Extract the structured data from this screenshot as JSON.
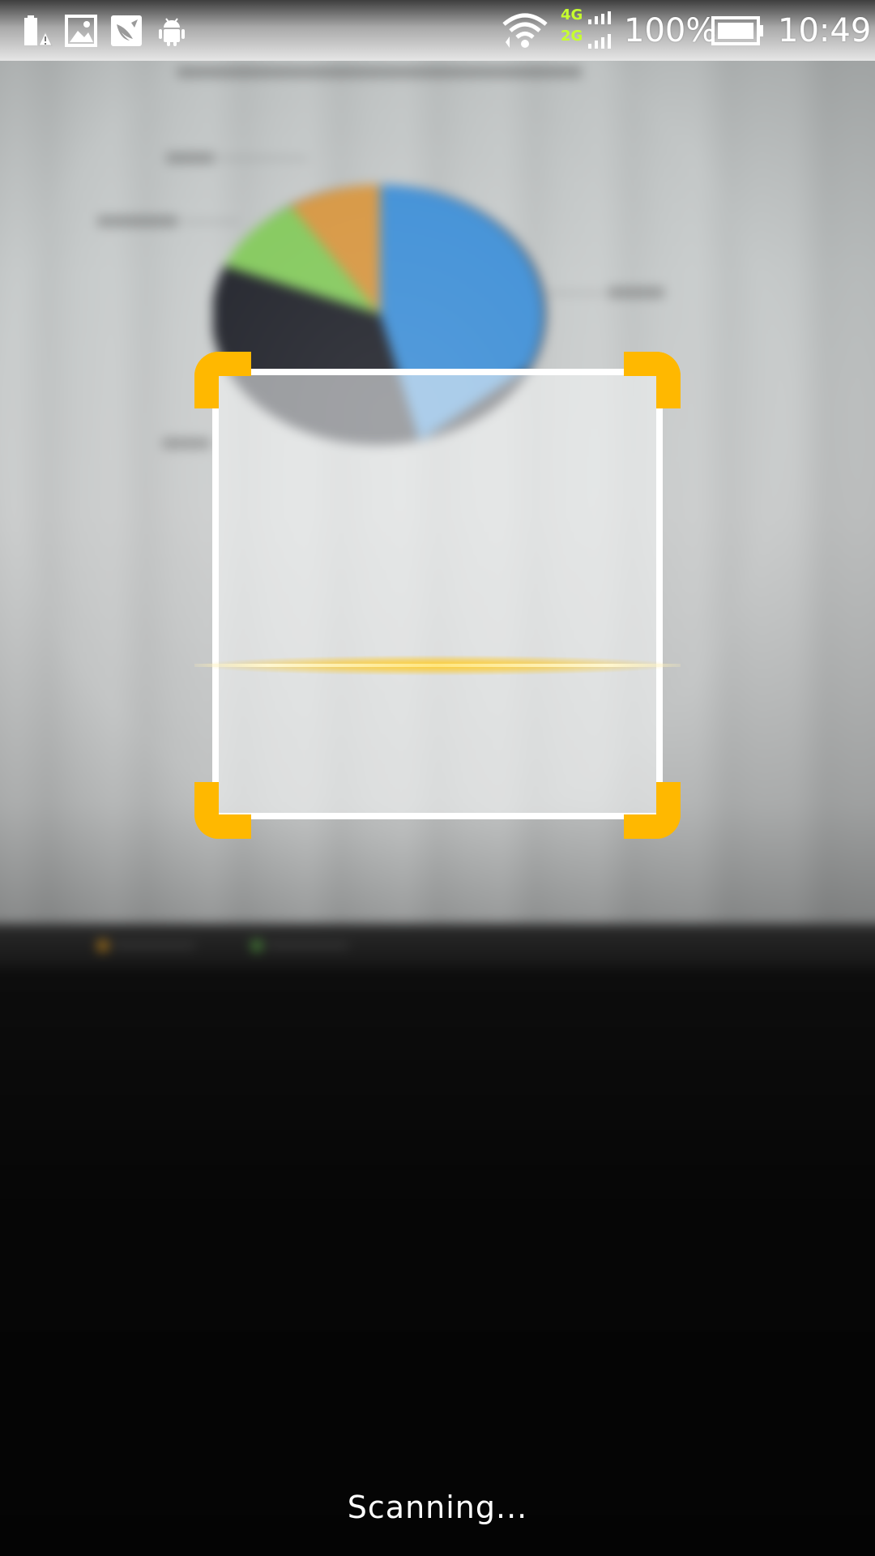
{
  "status_bar": {
    "network_top": "4G",
    "network_bottom": "2G",
    "battery_percent": "100%",
    "time": "10:49",
    "icons": [
      "battery-alert-icon",
      "image-icon",
      "bird-app-icon",
      "android-icon",
      "wifi-icon",
      "signal-icon",
      "battery-icon"
    ]
  },
  "scanner": {
    "status_text": "Scanning..."
  },
  "colors": {
    "accent": "#ffb800",
    "frame": "#ffffff",
    "network_label": "#c6ff2e"
  }
}
